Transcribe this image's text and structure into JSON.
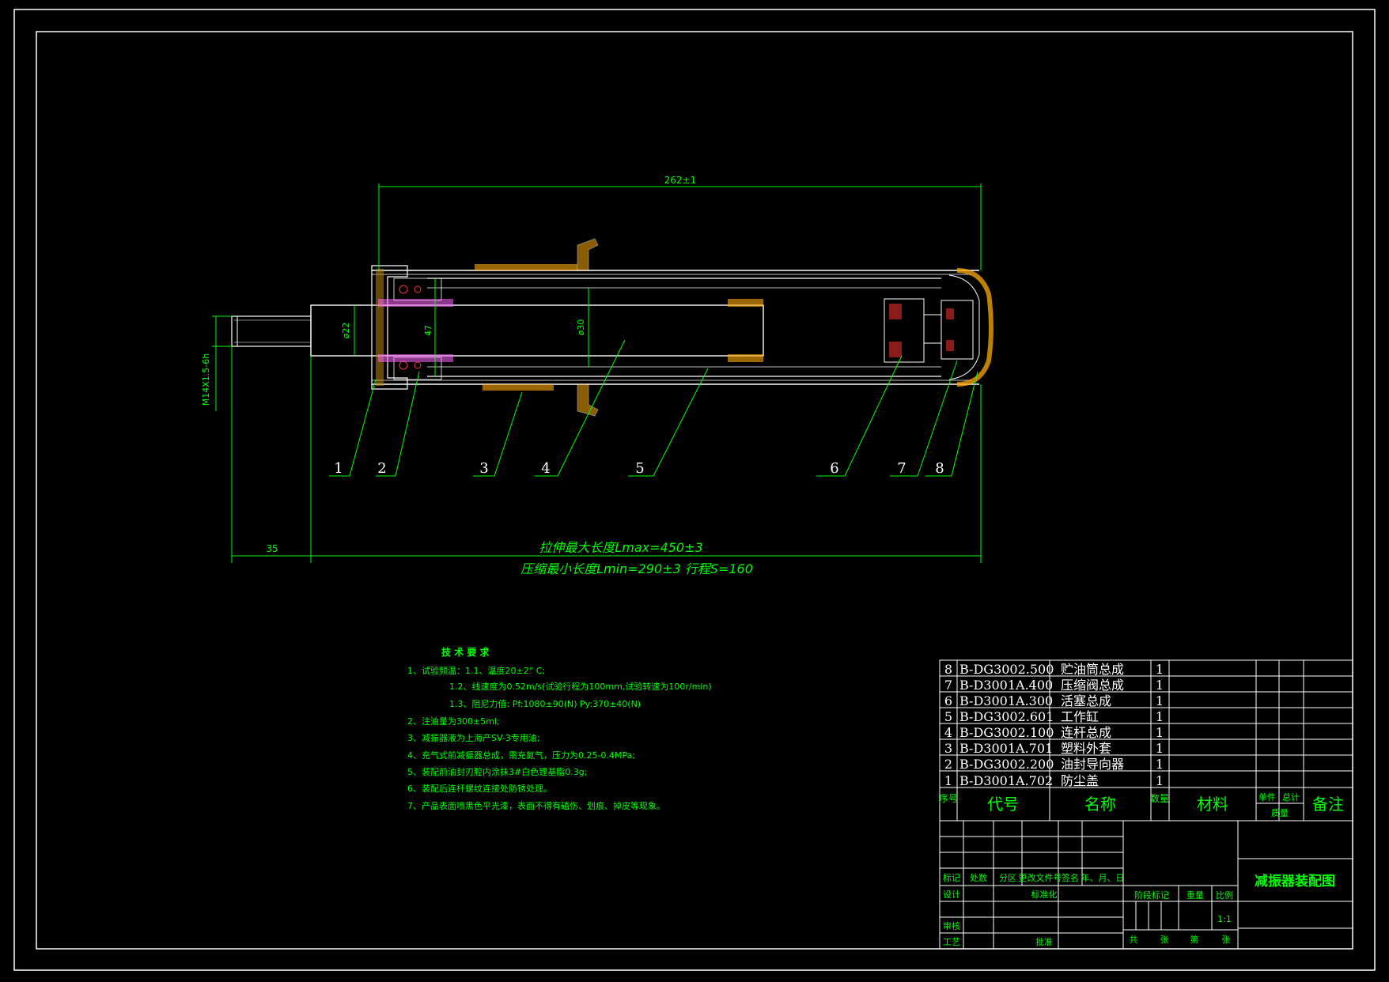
{
  "dimensions": {
    "overall_length": "262±1",
    "thread": "M14X1.5-6h",
    "rod_dia": "ø22",
    "guide_dia": "47",
    "cyl_dia": "ø30",
    "thread_len": "35",
    "lmax": "拉伸最大长度Lmax=450±3",
    "lmin": "压缩最小长度Lmin=290±3  行程S=160"
  },
  "callouts": [
    "1",
    "2",
    "3",
    "4",
    "5",
    "6",
    "7",
    "8"
  ],
  "tech": {
    "title": "技 术 要 求",
    "lines": [
      "1、试验频温：1.1、温度20±2° C;",
      "1.2、线速度为0.52m/s(试验行程为100mm,试验转速为100r/min)",
      "1.3、阻尼力值:   Pf:1080±90(N)   Py:370±40(N)",
      "2、注油量为300±5ml;",
      "3、减振器液为上海产SV-3专用油;",
      "4、充气式前减振器总成，需充氮气，压力为0.25-0.4MPa;",
      "5、装配前油封刃腔内涂抹3#白色锂基脂0.3g;",
      "6、装配后连杆螺纹连接处防锈处理。",
      "7、产品表面喷黑色平光漆，表面不得有磕伤、划痕、掉皮等现象。"
    ]
  },
  "parts": [
    {
      "no": "8",
      "code": "B-DG3002.500",
      "name": "贮油筒总成",
      "qty": "1"
    },
    {
      "no": "7",
      "code": "B-D3001A.400",
      "name": "压缩阀总成",
      "qty": "1"
    },
    {
      "no": "6",
      "code": "B-D3001A.300",
      "name": "活塞总成",
      "qty": "1"
    },
    {
      "no": "5",
      "code": "B-DG3002.601",
      "name": "工作缸",
      "qty": "1"
    },
    {
      "no": "4",
      "code": "B-DG3002.100",
      "name": "连杆总成",
      "qty": "1"
    },
    {
      "no": "3",
      "code": "B-D3001A.701",
      "name": "塑料外套",
      "qty": "1"
    },
    {
      "no": "2",
      "code": "B-DG3002.200",
      "name": "油封导向器",
      "qty": "1"
    },
    {
      "no": "1",
      "code": "B-D3001A.702",
      "name": "防尘盖",
      "qty": "1"
    }
  ],
  "header": {
    "seq": "序号",
    "code": "代号",
    "name": "名称",
    "qty": "数量",
    "material": "材料",
    "unit": "单件",
    "total": "总计",
    "mass": "质量",
    "note": "备注"
  },
  "titleblock": {
    "mark": "标记",
    "count": "处数",
    "zone": "分区",
    "change_doc": "更改文件号",
    "sign": "签名",
    "date": "年、月、日",
    "design": "设计",
    "std": "标准化",
    "stage": "阶段标记",
    "weight": "重量",
    "scale": "比例",
    "scale_val": "1:1",
    "review": "审核",
    "process": "工艺",
    "approve": "批准",
    "total_sheets": "共",
    "sheet_unit1": "张",
    "sheet_no": "第",
    "sheet_unit2": "张",
    "drawing_title": "减振器装配图"
  },
  "colors": {
    "line": "#ffffff",
    "dim": "#00ff00",
    "hatch": "#ffaa00",
    "accent": "#ff0000"
  }
}
